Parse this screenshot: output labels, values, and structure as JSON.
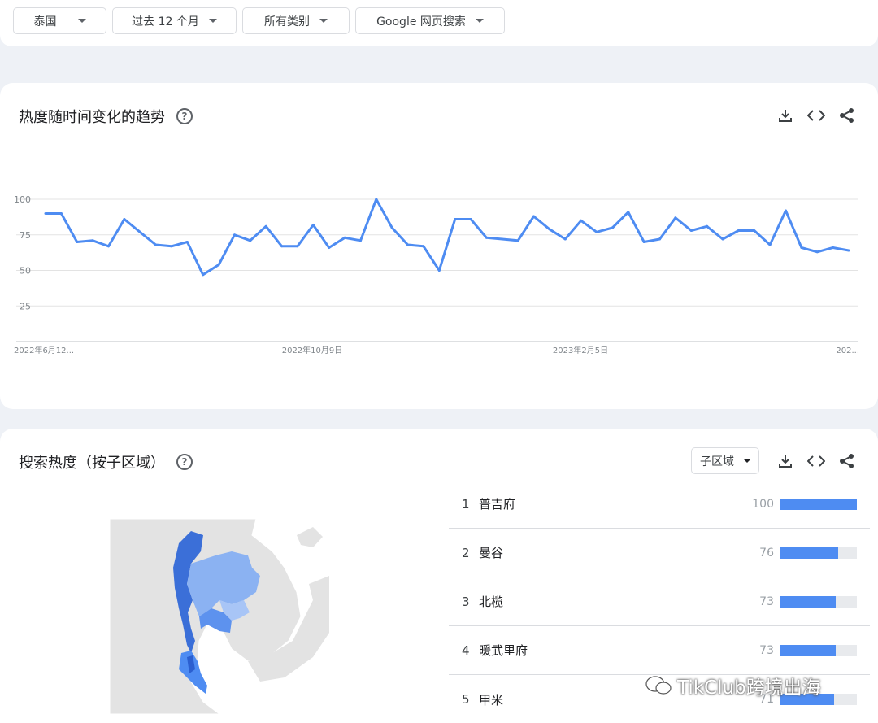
{
  "filters": [
    "泰国",
    "过去 12 个月",
    "所有类别",
    "Google 网页搜索"
  ],
  "trend_card": {
    "title": "热度随时间变化的趋势",
    "help": "?"
  },
  "chart_data": {
    "type": "line",
    "title": "",
    "xlabel": "",
    "ylabel": "",
    "ylim": [
      0,
      100
    ],
    "yticks": [
      "100",
      "75",
      "50",
      "25"
    ],
    "xtick_labels": [
      "2022年6月12...",
      "2022年10月9日",
      "2023年2月5日",
      "202..."
    ],
    "grid": true,
    "color": "#4e8cf2",
    "series": [
      {
        "values": [
          90,
          90,
          70,
          71,
          67,
          86,
          77,
          68,
          67,
          70,
          47,
          54,
          75,
          71,
          81,
          67,
          67,
          82,
          66,
          73,
          71,
          100,
          80,
          68,
          67,
          50,
          86,
          86,
          73,
          72,
          71,
          88,
          79,
          72,
          85,
          77,
          80,
          91,
          70,
          72,
          87,
          78,
          81,
          72,
          78,
          78,
          68,
          92,
          66,
          63,
          66,
          64
        ]
      }
    ]
  },
  "region_card": {
    "title": "搜索热度（按子区域）",
    "help": "?",
    "dropdown": "子区域",
    "rows": [
      {
        "rank": "1",
        "name": "普吉府",
        "value": "100",
        "fraction": 1.0
      },
      {
        "rank": "2",
        "name": "曼谷",
        "value": "76",
        "fraction": 0.76
      },
      {
        "rank": "3",
        "name": "北榄",
        "value": "73",
        "fraction": 0.73
      },
      {
        "rank": "4",
        "name": "暖武里府",
        "value": "73",
        "fraction": 0.73
      },
      {
        "rank": "5",
        "name": "甲米",
        "value": "71",
        "fraction": 0.71
      }
    ]
  },
  "watermark": "TikClub跨境出海"
}
